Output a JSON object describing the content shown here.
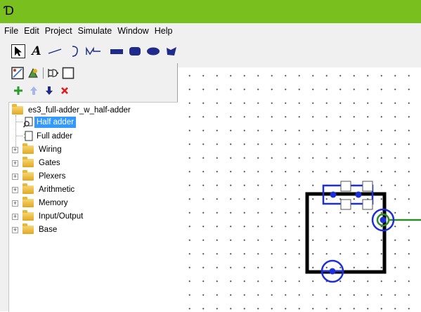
{
  "app": {
    "logo_glyph": "Ɗ"
  },
  "menubar": {
    "items": [
      {
        "label": "File"
      },
      {
        "label": "Edit"
      },
      {
        "label": "Project"
      },
      {
        "label": "Simulate"
      },
      {
        "label": "Window"
      },
      {
        "label": "Help"
      }
    ]
  },
  "toolbar": {
    "tools": [
      {
        "name": "select-tool-icon"
      },
      {
        "name": "text-tool-icon",
        "glyph": "A"
      },
      {
        "name": "wire-tool-icon"
      },
      {
        "name": "or-gate-tool-icon"
      },
      {
        "name": "xor-gate-tool-icon"
      },
      {
        "name": "rectangle-tool-icon"
      },
      {
        "name": "rounded-rect-tool-icon"
      },
      {
        "name": "oval-tool-icon"
      },
      {
        "name": "polygon-tool-icon"
      }
    ],
    "tool_color": "#1f2a8a"
  },
  "project_tree": {
    "project_name": "es3_full-adder_w_half-adder",
    "circuits": [
      {
        "label": "Half adder",
        "selected": true
      },
      {
        "label": "Full adder",
        "selected": false
      }
    ],
    "libraries": [
      {
        "label": "Wiring"
      },
      {
        "label": "Gates"
      },
      {
        "label": "Plexers"
      },
      {
        "label": "Arithmetic"
      },
      {
        "label": "Memory"
      },
      {
        "label": "Input/Output"
      },
      {
        "label": "Base"
      }
    ]
  },
  "colors": {
    "titlebar": "#79c01f",
    "selection": "#3399ff",
    "pin_blue": "#1c2fd9",
    "wire_green": "#2e8b2e"
  }
}
